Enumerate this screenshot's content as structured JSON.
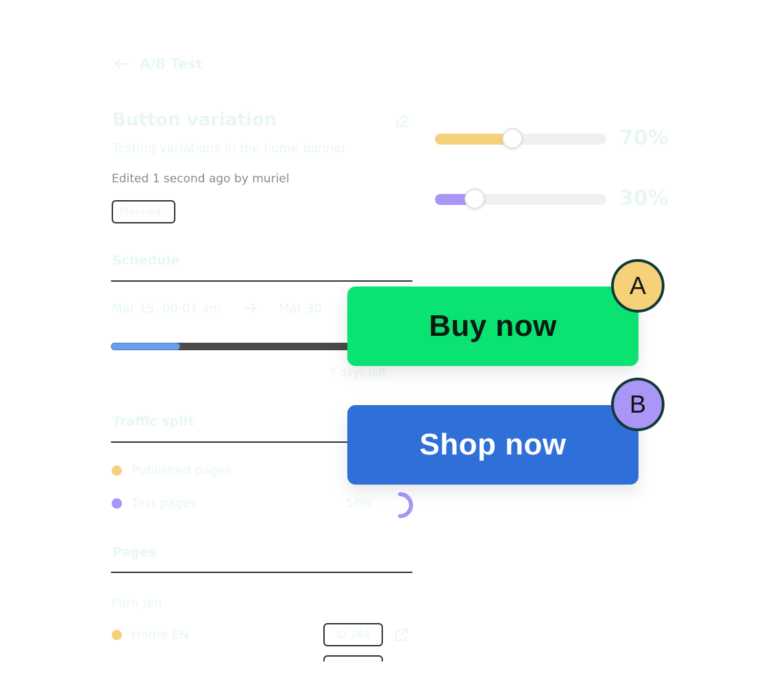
{
  "header": {
    "back_label": "A/B Test"
  },
  "test": {
    "title": "Button variation",
    "subtitle": "Testing variations in the home banner",
    "edited": "Edited 1 second ago by muriel",
    "status": "Planned"
  },
  "schedule": {
    "title": "Schedule",
    "start": "Mar 15, 00:01 am",
    "end": "Mar 30",
    "progress": 0.23,
    "days_left": "7 days left"
  },
  "traffic": {
    "title": "Traffic split",
    "items": [
      {
        "label": "Published pages",
        "color": "#f5d27a",
        "value": ""
      },
      {
        "label": "Test pages",
        "color": "#a996f7",
        "value": "50%"
      }
    ]
  },
  "pages": {
    "title": "Pages",
    "column": "Path /en",
    "rows": [
      {
        "label": "Home EN",
        "badge": "ID 264"
      }
    ]
  },
  "sliders": [
    {
      "value": 0.45,
      "label": "70%",
      "color": "#f5d27a"
    },
    {
      "value": 0.23,
      "label": "30%",
      "color": "#a996f7"
    }
  ],
  "variants": [
    {
      "letter": "A",
      "button_label": "Buy now",
      "button_color": "#0ae372",
      "text_color": "#0c1a12",
      "badge_color": "#f5d27a"
    },
    {
      "letter": "B",
      "button_label": "Shop now",
      "button_color": "#2f6fd8",
      "text_color": "#ffffff",
      "badge_color": "#a996f7"
    }
  ]
}
